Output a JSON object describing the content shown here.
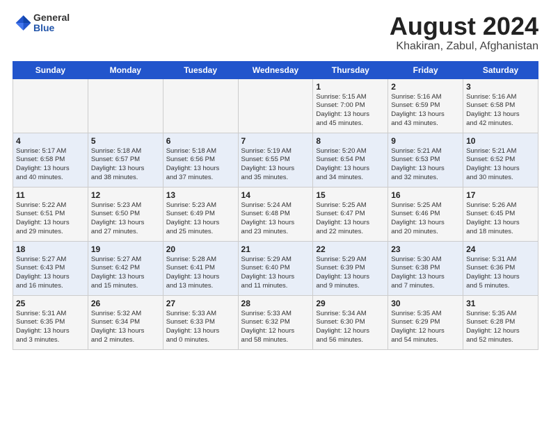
{
  "header": {
    "logo": {
      "general": "General",
      "blue": "Blue"
    },
    "title": "August 2024",
    "subtitle": "Khakiran, Zabul, Afghanistan"
  },
  "days_of_week": [
    "Sunday",
    "Monday",
    "Tuesday",
    "Wednesday",
    "Thursday",
    "Friday",
    "Saturday"
  ],
  "weeks": [
    [
      {
        "day": "",
        "info": ""
      },
      {
        "day": "",
        "info": ""
      },
      {
        "day": "",
        "info": ""
      },
      {
        "day": "",
        "info": ""
      },
      {
        "day": "1",
        "info": "Sunrise: 5:15 AM\nSunset: 7:00 PM\nDaylight: 13 hours\nand 45 minutes."
      },
      {
        "day": "2",
        "info": "Sunrise: 5:16 AM\nSunset: 6:59 PM\nDaylight: 13 hours\nand 43 minutes."
      },
      {
        "day": "3",
        "info": "Sunrise: 5:16 AM\nSunset: 6:58 PM\nDaylight: 13 hours\nand 42 minutes."
      }
    ],
    [
      {
        "day": "4",
        "info": "Sunrise: 5:17 AM\nSunset: 6:58 PM\nDaylight: 13 hours\nand 40 minutes."
      },
      {
        "day": "5",
        "info": "Sunrise: 5:18 AM\nSunset: 6:57 PM\nDaylight: 13 hours\nand 38 minutes."
      },
      {
        "day": "6",
        "info": "Sunrise: 5:18 AM\nSunset: 6:56 PM\nDaylight: 13 hours\nand 37 minutes."
      },
      {
        "day": "7",
        "info": "Sunrise: 5:19 AM\nSunset: 6:55 PM\nDaylight: 13 hours\nand 35 minutes."
      },
      {
        "day": "8",
        "info": "Sunrise: 5:20 AM\nSunset: 6:54 PM\nDaylight: 13 hours\nand 34 minutes."
      },
      {
        "day": "9",
        "info": "Sunrise: 5:21 AM\nSunset: 6:53 PM\nDaylight: 13 hours\nand 32 minutes."
      },
      {
        "day": "10",
        "info": "Sunrise: 5:21 AM\nSunset: 6:52 PM\nDaylight: 13 hours\nand 30 minutes."
      }
    ],
    [
      {
        "day": "11",
        "info": "Sunrise: 5:22 AM\nSunset: 6:51 PM\nDaylight: 13 hours\nand 29 minutes."
      },
      {
        "day": "12",
        "info": "Sunrise: 5:23 AM\nSunset: 6:50 PM\nDaylight: 13 hours\nand 27 minutes."
      },
      {
        "day": "13",
        "info": "Sunrise: 5:23 AM\nSunset: 6:49 PM\nDaylight: 13 hours\nand 25 minutes."
      },
      {
        "day": "14",
        "info": "Sunrise: 5:24 AM\nSunset: 6:48 PM\nDaylight: 13 hours\nand 23 minutes."
      },
      {
        "day": "15",
        "info": "Sunrise: 5:25 AM\nSunset: 6:47 PM\nDaylight: 13 hours\nand 22 minutes."
      },
      {
        "day": "16",
        "info": "Sunrise: 5:25 AM\nSunset: 6:46 PM\nDaylight: 13 hours\nand 20 minutes."
      },
      {
        "day": "17",
        "info": "Sunrise: 5:26 AM\nSunset: 6:45 PM\nDaylight: 13 hours\nand 18 minutes."
      }
    ],
    [
      {
        "day": "18",
        "info": "Sunrise: 5:27 AM\nSunset: 6:43 PM\nDaylight: 13 hours\nand 16 minutes."
      },
      {
        "day": "19",
        "info": "Sunrise: 5:27 AM\nSunset: 6:42 PM\nDaylight: 13 hours\nand 15 minutes."
      },
      {
        "day": "20",
        "info": "Sunrise: 5:28 AM\nSunset: 6:41 PM\nDaylight: 13 hours\nand 13 minutes."
      },
      {
        "day": "21",
        "info": "Sunrise: 5:29 AM\nSunset: 6:40 PM\nDaylight: 13 hours\nand 11 minutes."
      },
      {
        "day": "22",
        "info": "Sunrise: 5:29 AM\nSunset: 6:39 PM\nDaylight: 13 hours\nand 9 minutes."
      },
      {
        "day": "23",
        "info": "Sunrise: 5:30 AM\nSunset: 6:38 PM\nDaylight: 13 hours\nand 7 minutes."
      },
      {
        "day": "24",
        "info": "Sunrise: 5:31 AM\nSunset: 6:36 PM\nDaylight: 13 hours\nand 5 minutes."
      }
    ],
    [
      {
        "day": "25",
        "info": "Sunrise: 5:31 AM\nSunset: 6:35 PM\nDaylight: 13 hours\nand 3 minutes."
      },
      {
        "day": "26",
        "info": "Sunrise: 5:32 AM\nSunset: 6:34 PM\nDaylight: 13 hours\nand 2 minutes."
      },
      {
        "day": "27",
        "info": "Sunrise: 5:33 AM\nSunset: 6:33 PM\nDaylight: 13 hours\nand 0 minutes."
      },
      {
        "day": "28",
        "info": "Sunrise: 5:33 AM\nSunset: 6:32 PM\nDaylight: 12 hours\nand 58 minutes."
      },
      {
        "day": "29",
        "info": "Sunrise: 5:34 AM\nSunset: 6:30 PM\nDaylight: 12 hours\nand 56 minutes."
      },
      {
        "day": "30",
        "info": "Sunrise: 5:35 AM\nSunset: 6:29 PM\nDaylight: 12 hours\nand 54 minutes."
      },
      {
        "day": "31",
        "info": "Sunrise: 5:35 AM\nSunset: 6:28 PM\nDaylight: 12 hours\nand 52 minutes."
      }
    ]
  ]
}
